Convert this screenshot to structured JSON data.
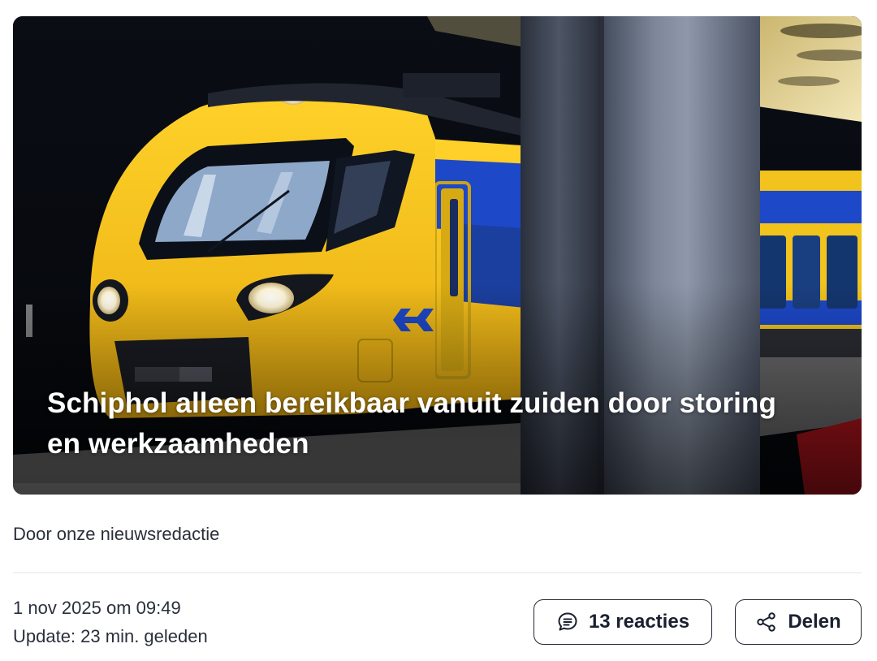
{
  "article": {
    "title": "Schiphol alleen bereikbaar vanuit zuiden door storing en werkzaamheden",
    "image_icon": "train-photo",
    "author": "Door onze nieuwsredactie",
    "published": "1 nov 2025 om 09:49",
    "updated": "Update: 23 min. geleden"
  },
  "actions": {
    "comments": {
      "label": "13 reacties",
      "icon": "comment-icon"
    },
    "share": {
      "label": "Delen",
      "icon": "share-icon"
    }
  },
  "colors": {
    "train_yellow": "#f5c21a",
    "train_blue": "#1d48c8",
    "text": "#1f2430",
    "button_border": "#232833"
  }
}
